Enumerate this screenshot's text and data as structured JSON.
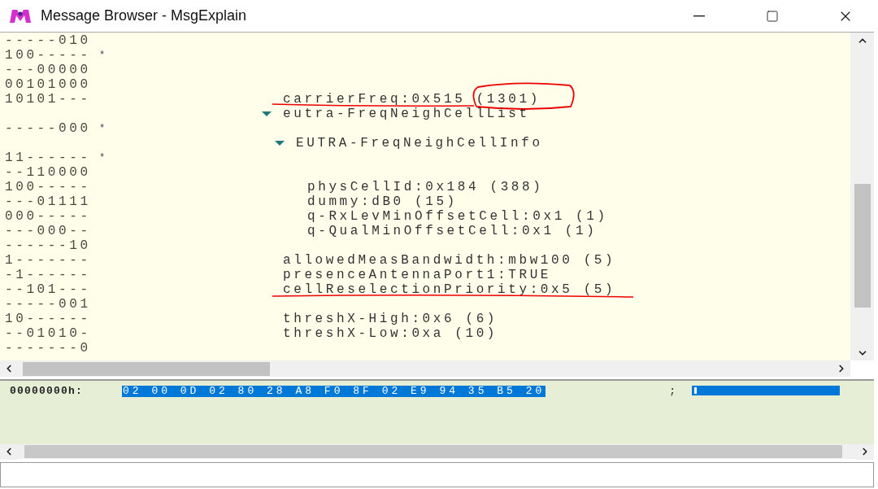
{
  "window": {
    "title": "Message Browser - MsgExplain"
  },
  "tree": {
    "rows": [
      {
        "bits": "-----010"
      },
      {
        "bits": "100-----",
        "star": "*"
      },
      {
        "bits": "---00000"
      },
      {
        "bits": "00101000"
      },
      {
        "bits": "10101---",
        "kind": "field",
        "text": "carrierFreq:0x515 (1301)",
        "underlined": true,
        "circled": true
      },
      {
        "kind": "expander",
        "text": "eutra-FreqNeighCellList",
        "expanded": true
      },
      {
        "bits": "-----000",
        "star": "*"
      },
      {
        "kind": "child-expander",
        "text": "EUTRA-FreqNeighCellInfo",
        "expanded": true
      },
      {
        "bits": "11------",
        "star": "*"
      },
      {
        "bits": "--110000"
      },
      {
        "bits": "100-----",
        "kind": "child-field",
        "text": "physCellId:0x184 (388)"
      },
      {
        "bits": "---01111",
        "kind": "child-field",
        "text": "dummy:dB0 (15)"
      },
      {
        "bits": "000-----",
        "kind": "child-field",
        "text": "q-RxLevMinOffsetCell:0x1 (1)"
      },
      {
        "bits": "---000--",
        "kind": "child-field",
        "text": "q-QualMinOffsetCell:0x1 (1)"
      },
      {
        "bits": "------10"
      },
      {
        "bits": "1-------",
        "kind": "field",
        "text": "allowedMeasBandwidth:mbw100 (5)"
      },
      {
        "bits": "-1------",
        "kind": "field",
        "text": "presenceAntennaPort1:TRUE"
      },
      {
        "bits": "--101---",
        "kind": "field",
        "text": "cellReselectionPriority:0x5 (5)",
        "underlined": true
      },
      {
        "bits": "-----001"
      },
      {
        "bits": "10------",
        "kind": "field",
        "text": "threshX-High:0x6 (6)"
      },
      {
        "bits": "--01010-",
        "kind": "field",
        "text": "threshX-Low:0xa (10)"
      },
      {
        "bits": "-------0"
      }
    ]
  },
  "hex": {
    "offset": "00000000h:",
    "bytes": "02 00 0D 02 80 28 A8 F0 8F 02 E9 94 35 B5 20",
    "selected": true,
    "separator": ";"
  }
}
